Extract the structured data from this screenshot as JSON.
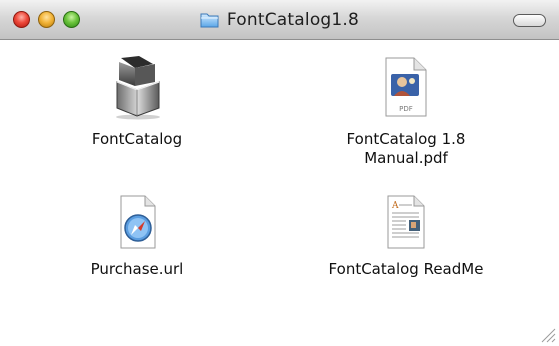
{
  "window": {
    "title": "FontCatalog1.8"
  },
  "items": [
    {
      "label": "FontCatalog"
    },
    {
      "label": "FontCatalog 1.8\nManual.pdf",
      "badge": "PDF"
    },
    {
      "label": "Purchase.url"
    },
    {
      "label": "FontCatalog ReadMe"
    }
  ]
}
